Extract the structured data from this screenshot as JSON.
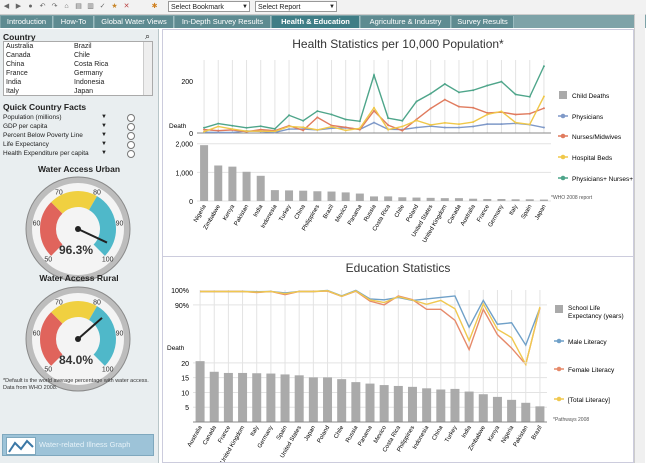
{
  "toolbar": {
    "bookmark_placeholder": "Select Bookmark",
    "report_placeholder": "Select Report"
  },
  "tabs": [
    {
      "label": "Introduction"
    },
    {
      "label": "How-To"
    },
    {
      "label": "Global Water Views"
    },
    {
      "label": "In-Depth Survey Results"
    },
    {
      "label": "Health & Education"
    },
    {
      "label": "Agriculture & Industry"
    },
    {
      "label": "Survey Results"
    }
  ],
  "country": {
    "title": "Country",
    "left": [
      "Australia",
      "Canada",
      "China",
      "France",
      "India",
      "Italy"
    ],
    "right": [
      "Brazil",
      "Chile",
      "Costa Rica",
      "Germany",
      "Indonesia",
      "Japan"
    ]
  },
  "quick_facts": {
    "title": "Quick Country Facts",
    "items": [
      "Population (millions)",
      "GDP per capita",
      "Percent Below Poverty Line",
      "Life Expectancy",
      "Health Expenditure per capita"
    ]
  },
  "gauges": [
    {
      "title": "Water Access Urban",
      "value": "96.3%",
      "level": 96.3,
      "ticks": [
        "50",
        "60",
        "70",
        "80",
        "90",
        "100"
      ]
    },
    {
      "title": "Water Access Rural",
      "value": "84.0%",
      "level": 84.0,
      "ticks": [
        "50",
        "60",
        "70",
        "80",
        "90",
        "100"
      ]
    }
  ],
  "note": "*Default is the world average percentage with water access. Data from WHO 2008.",
  "graph_button": "Water-related Illness Graph",
  "colors": {
    "child_deaths": "#aaaaaa",
    "physicians": "#7f99c8",
    "nurses": "#e07b5e",
    "hospital_beds": "#f0c84a",
    "phys_nurses_beds": "#4ea58a",
    "male": "#6fa0c8",
    "female": "#e68a6a",
    "total": "#f0c850"
  },
  "health": {
    "title": "Health Statistics per 10,000 Population*",
    "source": "*WHO 2008 report",
    "countries": [
      "Nigeria",
      "Zimbabwe",
      "Kenya",
      "Pakistan",
      "India",
      "Indonesia",
      "Turkey",
      "China",
      "Philippines",
      "Brazil",
      "Mexico",
      "Panama",
      "Russia",
      "Costa Rica",
      "Chile",
      "Poland",
      "United States",
      "United Kingdom",
      "Canada",
      "Australia",
      "France",
      "Germany",
      "Italy",
      "Spain",
      "Japan"
    ],
    "upper_axis_label": "Death",
    "upper_ticks": [
      "200",
      "0"
    ],
    "lower_ticks": [
      "2,000",
      "1,000",
      "0"
    ],
    "legend": [
      "Child Deaths",
      "Physicians",
      "Nurses/Midwives",
      "Hospital Beds",
      "Physicians+ Nurses+Beds"
    ],
    "chart_data": {
      "type": "bar+line",
      "child_deaths": [
        1950,
        1240,
        1200,
        1020,
        880,
        380,
        370,
        360,
        340,
        330,
        300,
        260,
        160,
        160,
        130,
        120,
        110,
        100,
        100,
        80,
        70,
        70,
        60,
        60,
        50
      ],
      "physicians": [
        3,
        2,
        2,
        8,
        6,
        2,
        15,
        15,
        12,
        18,
        20,
        14,
        40,
        14,
        13,
        21,
        26,
        21,
        21,
        25,
        34,
        34,
        37,
        32,
        21
      ],
      "nurses": [
        13,
        9,
        12,
        5,
        13,
        9,
        28,
        10,
        60,
        29,
        22,
        13,
        85,
        30,
        9,
        52,
        94,
        128,
        101,
        97,
        77,
        80,
        71,
        74,
        95
      ],
      "hospital_beds": [
        5,
        25,
        15,
        7,
        7,
        6,
        25,
        22,
        12,
        24,
        10,
        18,
        97,
        13,
        25,
        48,
        31,
        39,
        34,
        42,
        71,
        83,
        40,
        33,
        140
      ],
      "phys_nurses_beds": [
        20,
        36,
        28,
        20,
        26,
        16,
        68,
        47,
        84,
        71,
        52,
        45,
        222,
        57,
        47,
        121,
        151,
        188,
        156,
        164,
        182,
        197,
        148,
        139,
        256
      ]
    }
  },
  "education": {
    "title": "Education Statistics",
    "source": "*Pathways 2008",
    "countries": [
      "Australia",
      "Canada",
      "France",
      "United Kingdom",
      "Italy",
      "Germany",
      "Spain",
      "United States",
      "Japan",
      "Poland",
      "Chile",
      "Russia",
      "Panama",
      "Mexico",
      "Costa Rica",
      "Philippines",
      "Indonesia",
      "China",
      "Turkey",
      "India",
      "Zimbabwe",
      "Kenya",
      "Nigeria",
      "Pakistan",
      "Brazil"
    ],
    "upper_ticks": [
      "100%",
      "90%"
    ],
    "lower_axis_label": "Death",
    "lower_ticks": [
      "20",
      "15",
      "10",
      "5"
    ],
    "legend": [
      "School Life Expectancy (years)",
      "Male Literacy",
      "Female Literacy",
      "[Total Literacy]"
    ],
    "chart_data": {
      "type": "bar+line",
      "school_life": [
        20.6,
        17.0,
        16.6,
        16.6,
        16.5,
        16.4,
        16.1,
        15.8,
        15.1,
        15.1,
        14.5,
        13.5,
        13.0,
        12.5,
        12.2,
        11.9,
        11.4,
        11.0,
        11.2,
        10.3,
        9.4,
        8.5,
        7.5,
        6.5,
        5.3
      ],
      "male": [
        99,
        99,
        99,
        99,
        98.9,
        99,
        98,
        99,
        99,
        99.7,
        96,
        99.7,
        94,
        93.4,
        95,
        93,
        94,
        95,
        96,
        75,
        93,
        77,
        78,
        63,
        88
      ],
      "female": [
        99,
        99,
        99,
        99,
        98.3,
        99,
        96.9,
        99,
        99,
        99.3,
        95.7,
        99.2,
        92.5,
        90,
        96,
        93.5,
        87,
        87,
        79.6,
        60,
        87,
        70,
        61,
        38,
        88
      ],
      "total": [
        99,
        99,
        99,
        99,
        98.6,
        99,
        97.5,
        99,
        99,
        99.5,
        95.8,
        99.4,
        93.3,
        91.6,
        95.5,
        93.2,
        90.4,
        93,
        87.4,
        66,
        90.7,
        73.6,
        68,
        49.9,
        88.6
      ]
    }
  }
}
